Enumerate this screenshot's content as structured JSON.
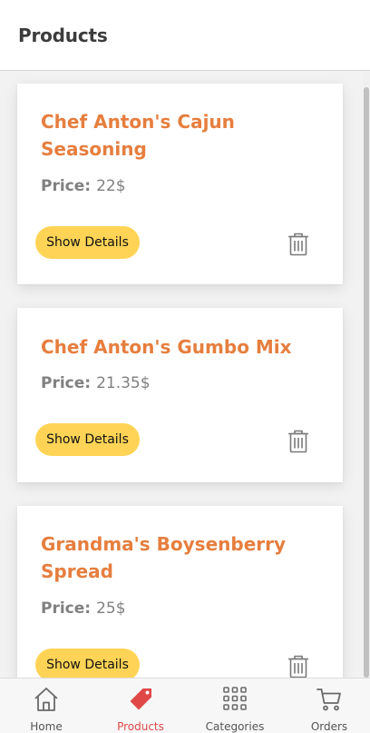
{
  "header": {
    "title": "Products"
  },
  "products": [
    {
      "name": "Chef Anton's Cajun Seasoning",
      "price_label": "Price:",
      "price": "22$",
      "details_label": "Show Details"
    },
    {
      "name": "Chef Anton's Gumbo Mix",
      "price_label": "Price:",
      "price": "21.35$",
      "details_label": "Show Details"
    },
    {
      "name": "Grandma's Boysenberry Spread",
      "price_label": "Price:",
      "price": "25$",
      "details_label": "Show Details"
    }
  ],
  "tabbar": {
    "active": "Products",
    "items": [
      {
        "label": "Home",
        "icon": "home-icon"
      },
      {
        "label": "Products",
        "icon": "tag-icon"
      },
      {
        "label": "Categories",
        "icon": "grid-icon"
      },
      {
        "label": "Orders",
        "icon": "cart-icon"
      }
    ]
  },
  "colors": {
    "accent_title": "#e67e3e",
    "button_bg": "#ffd456",
    "active_tab": "#e04848"
  }
}
